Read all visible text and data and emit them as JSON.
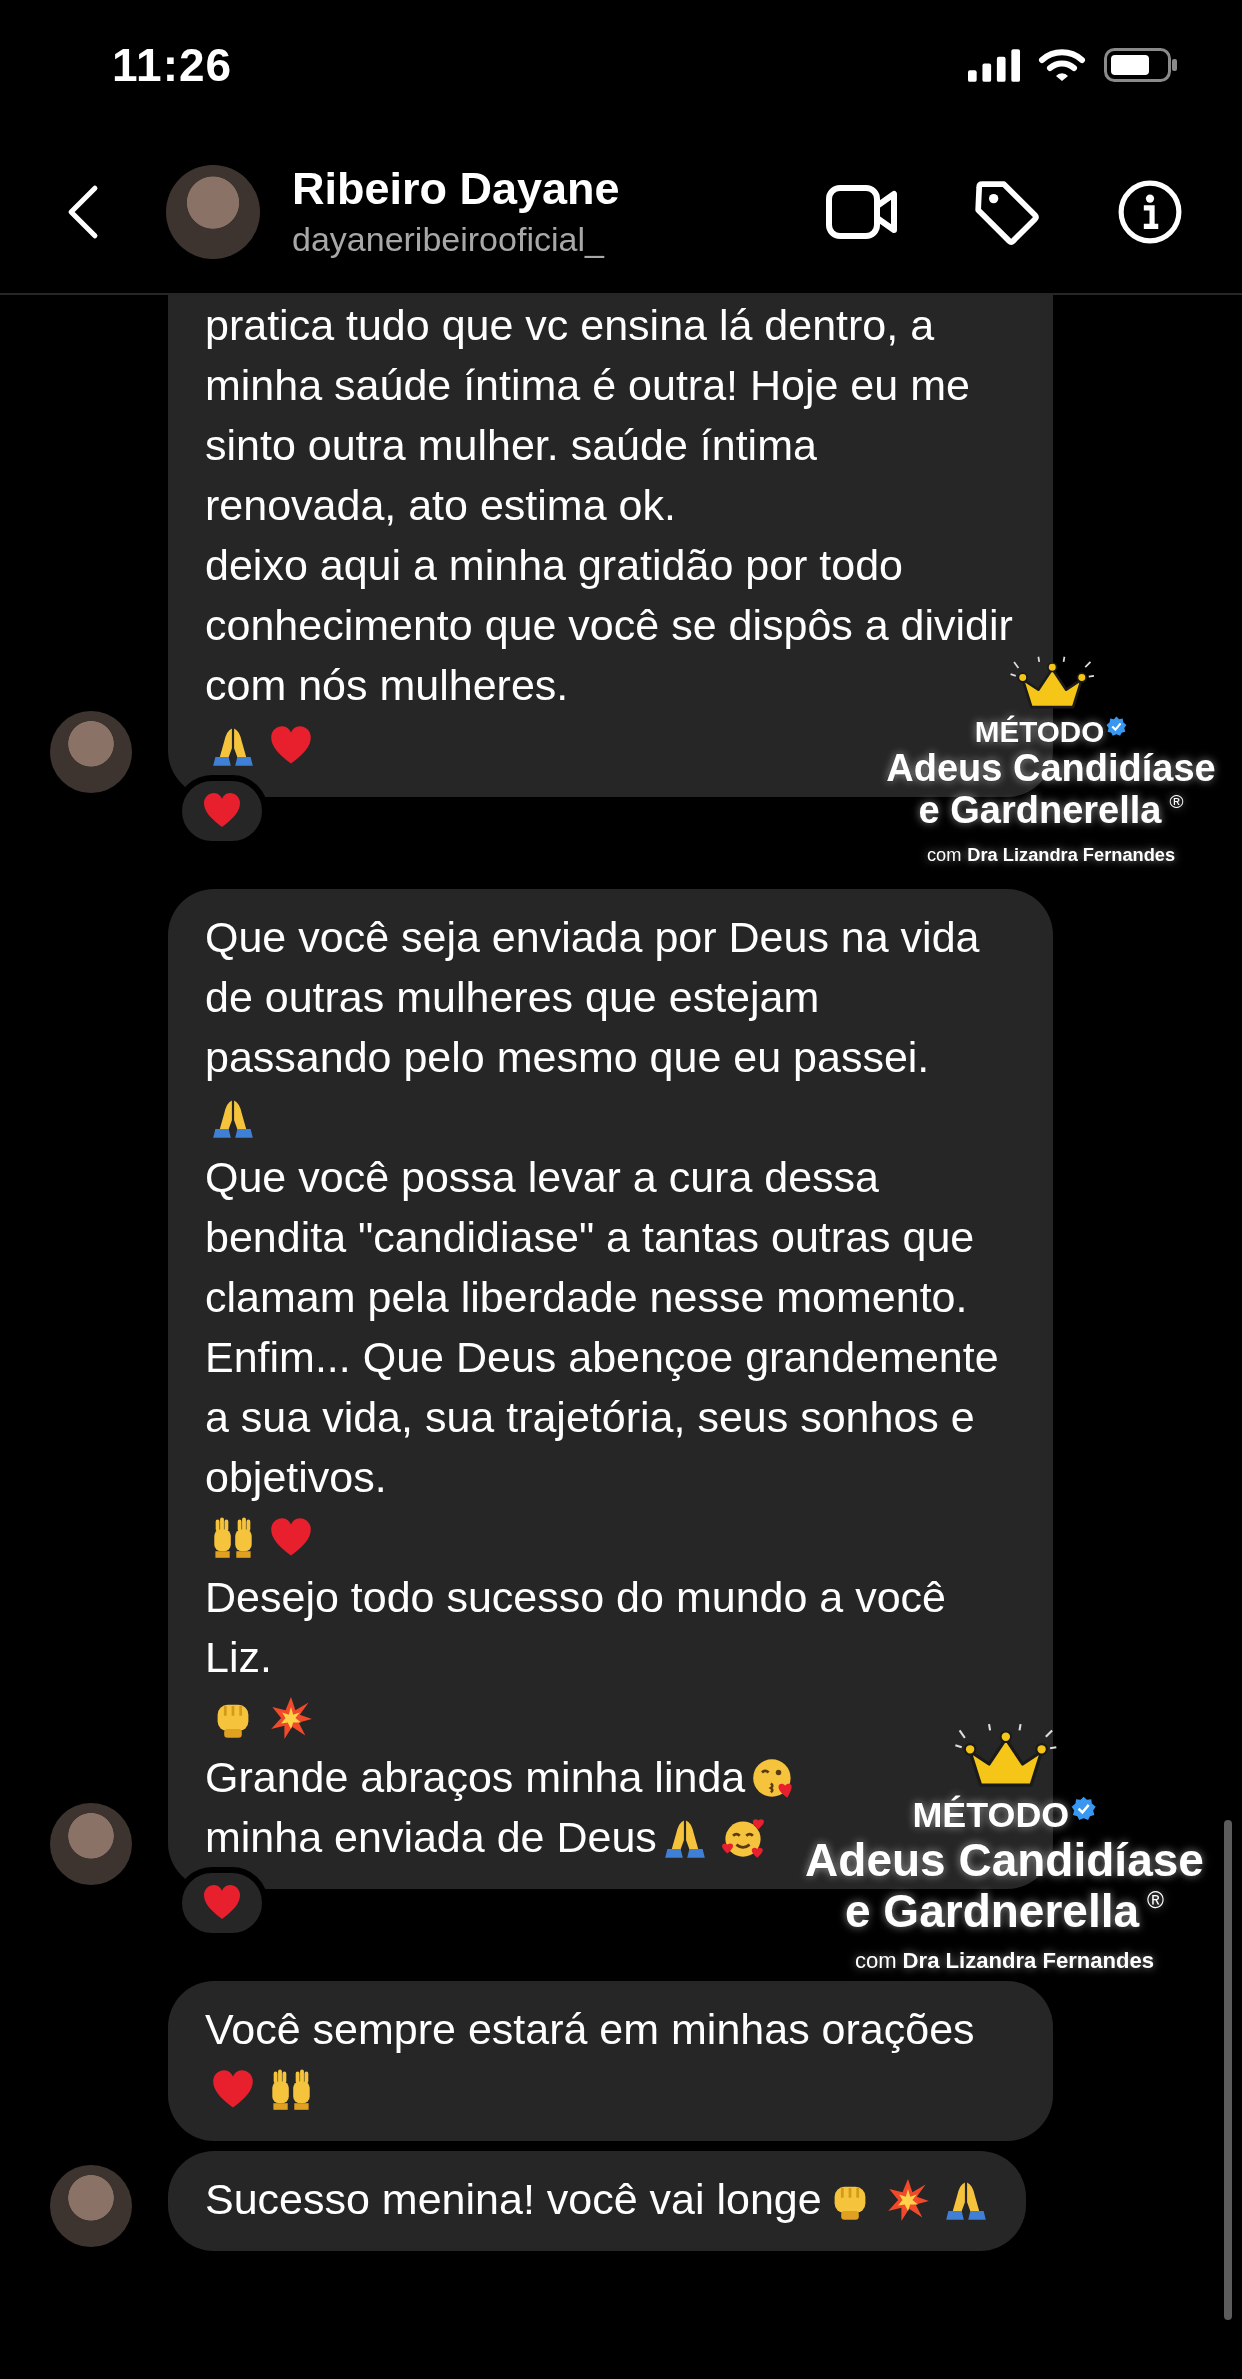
{
  "status_bar": {
    "time": "11:26"
  },
  "header": {
    "name": "Ribeiro Dayane",
    "username": "dayaneribeirooficial_"
  },
  "messages": [
    {
      "avatar": true,
      "cut_top": true,
      "reaction": {
        "kind": "heart"
      },
      "paragraphs": [
        [
          {
            "kind": "text",
            "text": "pratica tudo que vc ensina lá dentro, a minha saúde íntima é outra! Hoje eu me sinto outra mulher. saúde íntima renovada, ato estima ok."
          }
        ],
        [
          {
            "kind": "text",
            "text": "deixo aqui a minha gratidão por todo conhecimento que você se dispôs a dividir com nós mulheres."
          },
          {
            "kind": "pray"
          },
          {
            "kind": "heart"
          }
        ]
      ]
    },
    {
      "avatar": true,
      "cut_top": false,
      "reaction": {
        "kind": "heart"
      },
      "paragraphs": [
        [
          {
            "kind": "text",
            "text": "Que você seja enviada por Deus  na vida de outras mulheres que estejam passando pelo mesmo que eu passei."
          },
          {
            "kind": "pray"
          }
        ],
        [
          {
            "kind": "text",
            "text": "Que você possa levar a cura dessa bendita \"candidiase\" a tantas outras que clamam pela liberdade nesse momento."
          }
        ],
        [
          {
            "kind": "text",
            "text": "Enfim... Que Deus abençoe grandemente a sua vida, sua trajetória, seus sonhos e objetivos."
          },
          {
            "kind": "raised_hands"
          },
          {
            "kind": "heart"
          }
        ],
        [
          {
            "kind": "text",
            "text": "Desejo todo sucesso do mundo a você Liz."
          },
          {
            "kind": "fist"
          },
          {
            "kind": "collision"
          }
        ],
        [
          {
            "kind": "text",
            "text": "Grande abraços minha linda"
          },
          {
            "kind": "kiss"
          }
        ],
        [
          {
            "kind": "text",
            "text": "minha enviada de Deus"
          },
          {
            "kind": "pray"
          },
          {
            "kind": "smiling_hearts"
          }
        ]
      ]
    },
    {
      "avatar": false,
      "cut_top": false,
      "paragraphs": [
        [
          {
            "kind": "text",
            "text": "Você sempre estará em minhas orações"
          },
          {
            "kind": "heart"
          },
          {
            "kind": "raised_hands"
          }
        ]
      ]
    },
    {
      "avatar": true,
      "cut_top": false,
      "paragraphs": [
        [
          {
            "kind": "text",
            "text": "Sucesso menina! você vai longe"
          },
          {
            "kind": "fist"
          },
          {
            "kind": "collision"
          },
          {
            "kind": "pray"
          }
        ]
      ]
    }
  ],
  "overlays": [
    {
      "label": "MÉTODO",
      "verified": true,
      "title_lines": [
        "Adeus Candidíase",
        "e Gardnerella"
      ],
      "mark": "®",
      "byline_prefix": "com",
      "byline_name": "Dra Lizandra Fernandes"
    },
    {
      "label": "MÉTODO",
      "verified": true,
      "title_lines": [
        "Adeus Candidíase",
        "e Gardnerella"
      ],
      "mark": "®",
      "byline_prefix": "com",
      "byline_name": "Dra Lizandra Fernandes"
    }
  ]
}
